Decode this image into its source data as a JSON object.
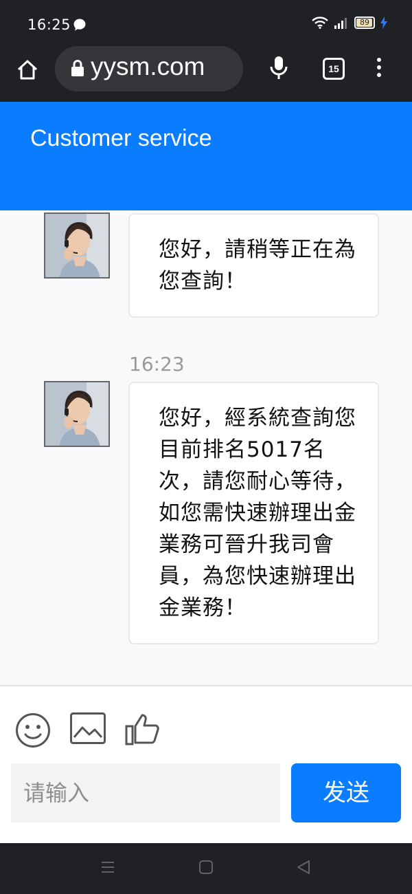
{
  "status_bar": {
    "time": "16:25",
    "battery": "89"
  },
  "browser": {
    "url": "yysm.com",
    "tab_count": "15"
  },
  "header": {
    "title": "Customer service"
  },
  "chat": {
    "messages": [
      {
        "text": "您好，請稍等正在為您查詢！"
      },
      {
        "time": "16:23",
        "text": "您好，經系統查詢您目前排名5017名次，請您耐心等待，如您需快速辦理出金業務可晉升我司會員，為您快速辦理出金業務！"
      }
    ]
  },
  "composer": {
    "placeholder": "请输入",
    "send_label": "发送",
    "tools": [
      "emoji-icon",
      "image-icon",
      "thumbs-up-icon"
    ]
  },
  "colors": {
    "accent": "#0a7cff",
    "system_bar": "#202124"
  }
}
